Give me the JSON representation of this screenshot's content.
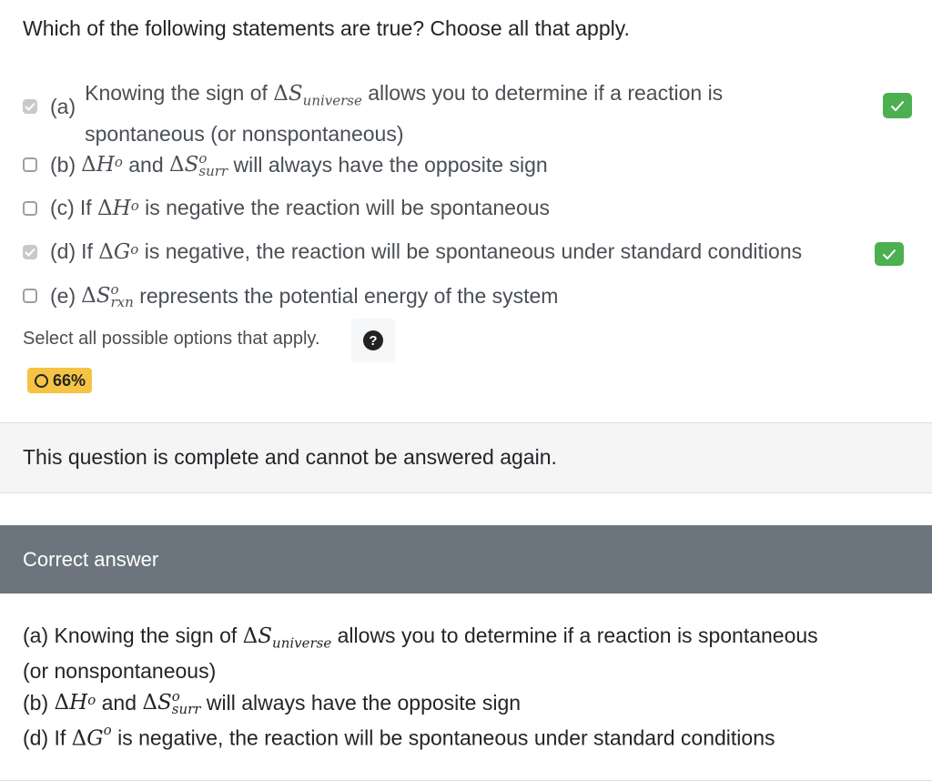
{
  "question": {
    "prompt": "Which of the following statements are true? Choose all that apply."
  },
  "options": [
    {
      "letter": "(a)",
      "pre": "Knowing the sign of ",
      "sym": "S",
      "sub": "universe",
      "sup": "",
      "post": " allows you to determine if a reaction is",
      "line2": "spontaneous (or nonspontaneous)",
      "checked": true,
      "correct": true
    },
    {
      "letter": "(b)",
      "sym1": "H",
      "sup1": "o",
      "mid": " and ",
      "sym2": "S",
      "sup2": "o",
      "sub2": "surr",
      "post": " will always have the opposite sign",
      "checked": false,
      "correct": false
    },
    {
      "letter": "(c)",
      "pre": "If ",
      "sym": "H",
      "sup": "o",
      "post": " is negative the reaction will be spontaneous",
      "checked": false,
      "correct": false
    },
    {
      "letter": "(d)",
      "pre": "If ",
      "sym": "G",
      "sup": "o",
      "post": " is negative, the reaction will be spontaneous under standard conditions",
      "checked": true,
      "correct": true
    },
    {
      "letter": "(e)",
      "sym": "S",
      "sup": "o",
      "sub": "rxn",
      "post": " represents the potential energy of the system",
      "checked": false,
      "correct": false
    }
  ],
  "hint": "Select all possible options that apply.",
  "help_icon": "question-circle-icon",
  "score": "66%",
  "complete_message": "This question is complete and cannot be answered again.",
  "correct_answer": {
    "header": "Correct answer",
    "lines": {
      "a_pre": "(a) Knowing the sign of ",
      "a_post": " allows you to determine if a reaction is spontaneous",
      "a_line2": "(or nonspontaneous)",
      "b_pre": "(b) ",
      "b_mid": " and ",
      "b_post": " will always have the opposite sign",
      "d_pre": "(d) If ",
      "d_post": " is negative, the reaction will be spontaneous under standard conditions"
    }
  },
  "colors": {
    "correct_badge": "#4caf50",
    "score_badge": "#f6c342",
    "header_bg": "#6c757d"
  }
}
